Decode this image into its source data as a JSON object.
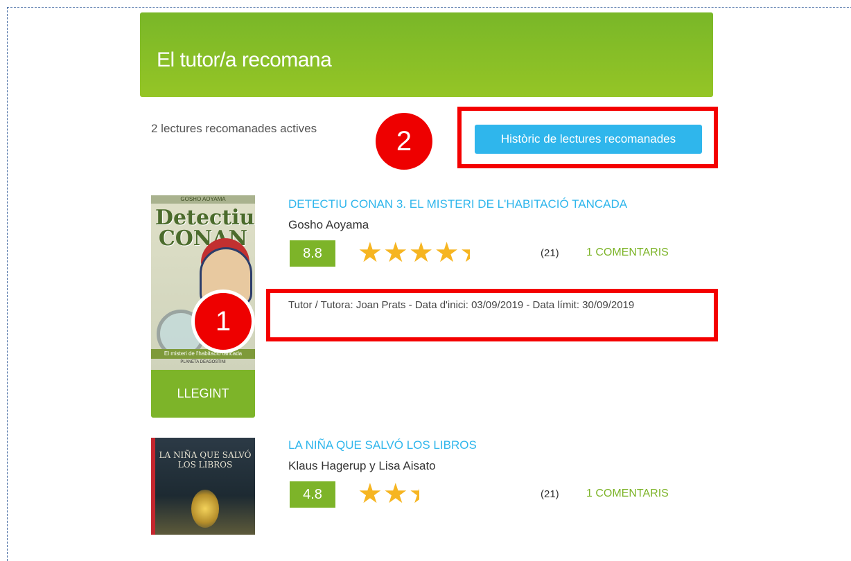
{
  "header": {
    "title": "El tutor/a recomana"
  },
  "summary": {
    "active_count": "2 lectures recomanades actives"
  },
  "history_button": {
    "label": "Històric de lectures recomanades"
  },
  "markers": {
    "one": "1",
    "two": "2"
  },
  "books": [
    {
      "title": "DETECTIU CONAN 3. EL MISTERI DE L'HABITACIÓ TANCADA",
      "author": "Gosho Aoyama",
      "rating": "8.8",
      "stars": 4.5,
      "votes": "(21)",
      "comments": "1 COMENTARIS",
      "tutor_line": "Tutor / Tutora: Joan Prats - Data d'inici: 03/09/2019 - Data límit: 30/09/2019",
      "status": "LLEGINT",
      "cover": {
        "publisher_top": "GOSHO AOYAMA",
        "title": "Detectiu CONAN",
        "subtitle": "El misteri de l'habitació tancada",
        "publisher": "PLANETA DEAGOSTINI"
      }
    },
    {
      "title": "LA NIÑA QUE SALVÓ LOS LIBROS",
      "author": "Klaus Hagerup y Lisa Aisato",
      "rating": "4.8",
      "stars": 2.5,
      "votes": "(21)",
      "comments": "1 COMENTARIS",
      "cover": {
        "title": "LA NIÑA QUE SALVÓ LOS LIBROS"
      }
    }
  ],
  "colors": {
    "header_green": "#8dc126",
    "action_green": "#7db429",
    "link_blue": "#2fb6ec",
    "star_gold": "#f6b521",
    "highlight_red": "#f40000"
  }
}
